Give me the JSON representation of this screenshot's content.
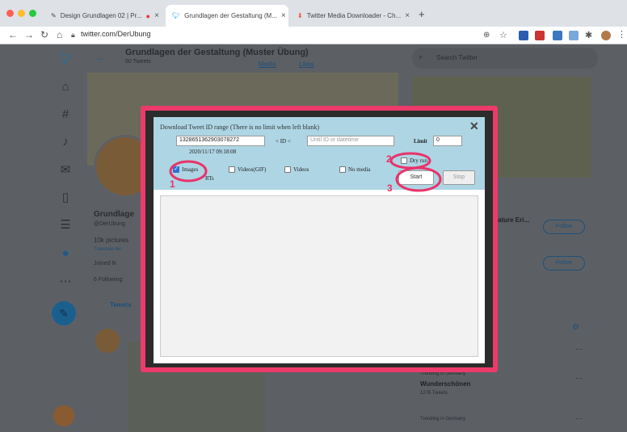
{
  "browser": {
    "tabs": [
      {
        "label": "Design Grundlagen 02 | Pr..."
      },
      {
        "label": "Grundlagen der Gestaltung (M..."
      },
      {
        "label": "Twitter Media Downloader - Ch..."
      }
    ],
    "new_tab": "+",
    "url": "twitter.com/DerUbung"
  },
  "twitter": {
    "header_title": "Grundlagen der Gestaltung (Muster Übung)",
    "header_sub": "60 Tweets",
    "tab_media": "Media",
    "tab_likes": "Likes",
    "search_placeholder": "Search Twitter",
    "profile_name": "Grundlage",
    "profile_handle": "@DerUbung",
    "profile_bio": "10k pictures",
    "translate": "Translate bio",
    "joined": "Joined N",
    "following": "6 Following",
    "tweets_tab": "Tweets",
    "who_name": "ature Eri...",
    "follow1": "Follow",
    "follow2": "Follow",
    "trend_label1": "Trending in Germany",
    "trend_title": "Wunderschönen",
    "trend_count": "1276 Tweets",
    "trend_label2": "Trending in Germany"
  },
  "dialog": {
    "title": "Download Tweet ID range (There is no limit when left blank)",
    "id_from": "1328651362903078272",
    "id_from_date": "2020/11/17 09:18:08",
    "relation": "< ID <",
    "id_to_placeholder": "Until ID or datetime",
    "limit_label": "Limit",
    "limit_value": "0",
    "options": [
      {
        "label": "Images",
        "checked": true
      },
      {
        "label": "Videos(GIF)",
        "checked": false
      },
      {
        "label": "Videos",
        "checked": false
      },
      {
        "label": "No media",
        "checked": false
      }
    ],
    "rts_label": "RTs",
    "dry_run_label": "Dry run",
    "start_label": "Start",
    "stop_label": "Stop",
    "close": "✕"
  },
  "annotations": [
    "1",
    "2",
    "3"
  ],
  "colors": {
    "highlight": "#ec3a6a",
    "dialog_header": "#aed5e4"
  }
}
